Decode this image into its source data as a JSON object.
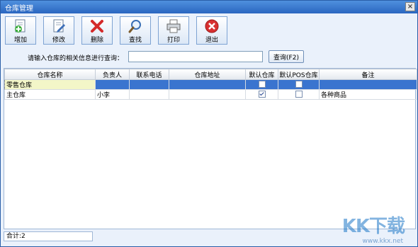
{
  "window": {
    "title": "仓库管理",
    "close_label": "×"
  },
  "toolbar": {
    "items": [
      {
        "label": "增加",
        "icon": "add-document-icon"
      },
      {
        "label": "修改",
        "icon": "edit-document-icon"
      },
      {
        "label": "删除",
        "icon": "delete-x-icon"
      },
      {
        "label": "查找",
        "icon": "magnifier-icon"
      },
      {
        "label": "打印",
        "icon": "printer-icon"
      },
      {
        "label": "退出",
        "icon": "exit-icon"
      }
    ]
  },
  "search": {
    "prompt": "请输入仓库的相关信息进行查询：",
    "value": "",
    "button_label": "查询(F2)"
  },
  "table": {
    "columns": [
      "仓库名称",
      "负责人",
      "联系电话",
      "仓库地址",
      "默认仓库",
      "默认POS仓库",
      "备注"
    ],
    "rows": [
      {
        "name": "零售仓库",
        "manager": "",
        "phone": "",
        "address": "",
        "default": false,
        "default_pos": false,
        "note": "",
        "selected": true
      },
      {
        "name": "主仓库",
        "manager": "小李",
        "phone": "",
        "address": "",
        "default": true,
        "default_pos": false,
        "note": "各种商品",
        "selected": false
      }
    ]
  },
  "status": {
    "total": "合计:2"
  },
  "watermark": {
    "logo": "KK下载",
    "url": "www.kkx.net"
  },
  "colors": {
    "title_bar": "#2a66c0",
    "selection": "#3a74cf",
    "window_bg": "#eaf1fb"
  }
}
